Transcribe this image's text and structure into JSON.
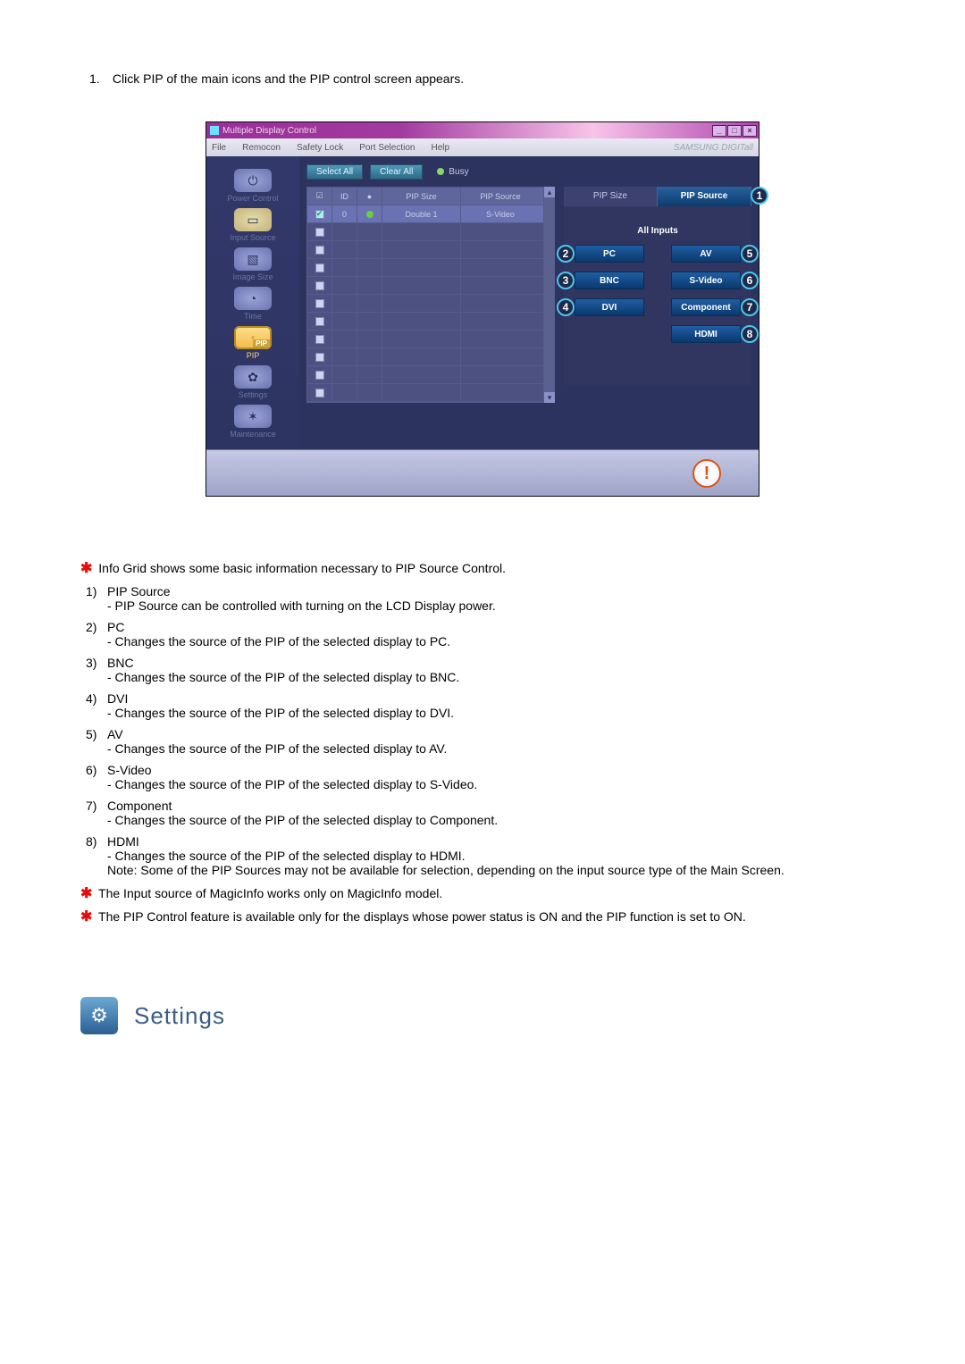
{
  "intro": {
    "num": "1.",
    "text": "Click PIP of the main icons and the PIP control screen appears."
  },
  "window": {
    "title": "Multiple Display Control",
    "winbtns": {
      "min": "_",
      "max": "□",
      "close": "×"
    },
    "menubar": [
      "File",
      "Remocon",
      "Safety Lock",
      "Port Selection",
      "Help"
    ],
    "brand": "SAMSUNG DIGITall",
    "toolbar": {
      "select_all": "Select All",
      "clear_all": "Clear All",
      "busy": "Busy"
    },
    "sidebar": [
      {
        "label": "Power Control",
        "glyph": "⏻"
      },
      {
        "label": "Input Source",
        "glyph": "▭"
      },
      {
        "label": "Image Size",
        "glyph": "▧"
      },
      {
        "label": "Time",
        "glyph": "◔"
      },
      {
        "label": "PIP",
        "glyph": "▫",
        "active": true,
        "badge": "PIP"
      },
      {
        "label": "Settings",
        "glyph": "✿"
      },
      {
        "label": "Maintenance",
        "glyph": "✶"
      }
    ],
    "grid": {
      "headers": [
        "☑",
        "ID",
        "●",
        "PIP Size",
        "PIP Source"
      ],
      "first_row": {
        "checked": true,
        "id": "0",
        "status": "on",
        "size": "Double 1",
        "source": "S-Video"
      }
    },
    "right": {
      "tabs": {
        "size": "PIP Size",
        "source": "PIP Source"
      },
      "all_inputs": "All Inputs",
      "buttons": {
        "pc": "PC",
        "av": "AV",
        "bnc": "BNC",
        "svideo": "S-Video",
        "dvi": "DVI",
        "component": "Component",
        "hdmi": "HDMI"
      },
      "callouts": {
        "source": "1",
        "pc": "2",
        "bnc": "3",
        "dvi": "4",
        "av": "5",
        "svideo": "6",
        "component": "7",
        "hdmi": "8"
      }
    },
    "status_orb": "!"
  },
  "notes": {
    "star_intro": "Info Grid shows some basic information necessary to PIP Source Control.",
    "items": [
      {
        "n": "1)",
        "t": "PIP Source",
        "d": "- PIP Source can be controlled with turning on the LCD Display power."
      },
      {
        "n": "2)",
        "t": "PC",
        "d": "- Changes the source of the PIP of the selected display to PC."
      },
      {
        "n": "3)",
        "t": "BNC",
        "d": "- Changes the source of the PIP of the selected display to BNC."
      },
      {
        "n": "4)",
        "t": "DVI",
        "d": "- Changes the source of the PIP of the selected display to DVI."
      },
      {
        "n": "5)",
        "t": "AV",
        "d": "- Changes the source of the PIP of the selected display to AV."
      },
      {
        "n": "6)",
        "t": "S-Video",
        "d": "- Changes the source of the PIP of the selected display to S-Video."
      },
      {
        "n": "7)",
        "t": "Component",
        "d": "- Changes the source of the PIP of the selected display to Component."
      },
      {
        "n": "8)",
        "t": "HDMI",
        "d": "- Changes the source of the PIP of the selected display to HDMI."
      }
    ],
    "note_line": "Note: Some of the PIP Sources may not be available for selection, depending on the input source type of the Main Screen.",
    "star2": "The Input source of MagicInfo works only on MagicInfo model.",
    "star3": "The PIP Control feature is available only for the displays whose power status is ON and the PIP function is set to ON."
  },
  "section": {
    "title": "Settings"
  }
}
